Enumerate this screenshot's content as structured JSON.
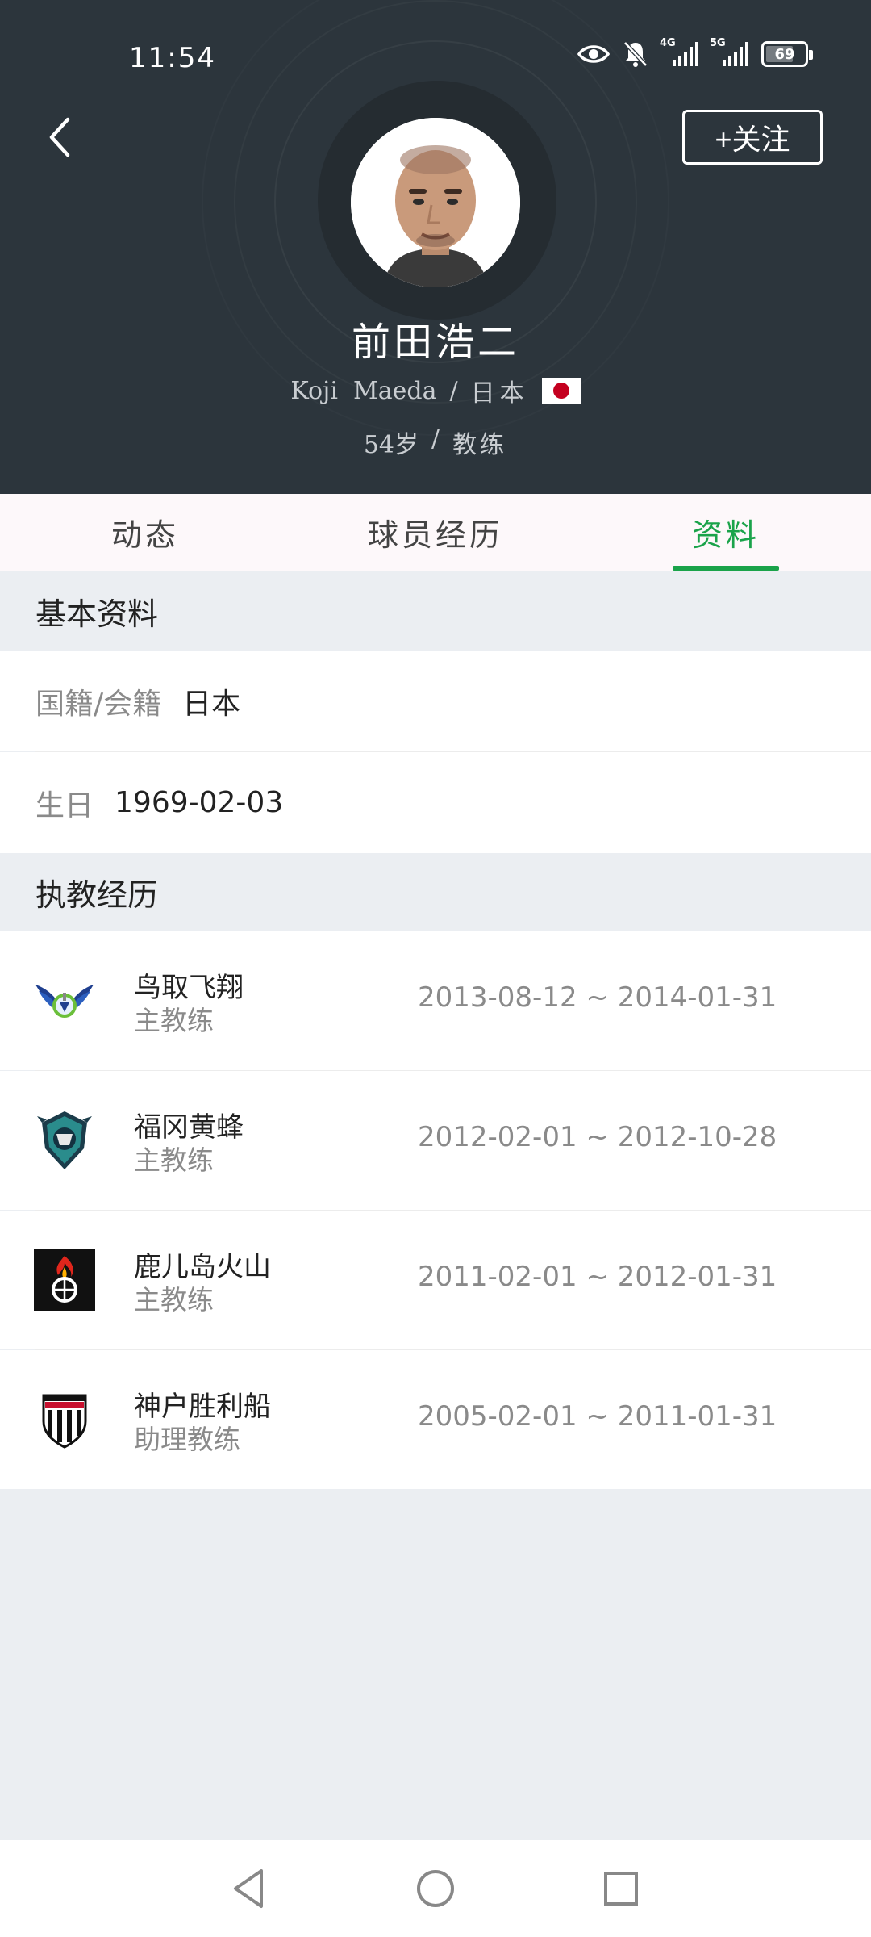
{
  "status_bar": {
    "time": "11:54",
    "network_1": "4G",
    "network_2": "5G",
    "battery": "69"
  },
  "header": {
    "follow_label": "+关注",
    "name": "前田浩二",
    "english_name": "Koji  Maeda",
    "sep": "/",
    "country": "日本",
    "age": "54岁",
    "role": "教练"
  },
  "tabs": [
    {
      "label": "动态",
      "active": false
    },
    {
      "label": "球员经历",
      "active": false
    },
    {
      "label": "资料",
      "active": true
    }
  ],
  "basic_info": {
    "title": "基本资料",
    "nationality_label": "国籍/会籍",
    "nationality_value": "日本",
    "birthday_label": "生日",
    "birthday_value": "1969-02-03"
  },
  "coaching": {
    "title": "执教经历",
    "items": [
      {
        "club": "鸟取飞翔",
        "role": "主教练",
        "dates": "2013-08-12 ~ 2014-01-31",
        "logo": "gainare-tottori-logo"
      },
      {
        "club": "福冈黄蜂",
        "role": "主教练",
        "dates": "2012-02-01 ~ 2012-10-28",
        "logo": "avispa-fukuoka-logo"
      },
      {
        "club": "鹿儿岛火山",
        "role": "主教练",
        "dates": "2011-02-01 ~ 2012-01-31",
        "logo": "volca-kagoshima-logo"
      },
      {
        "club": "神户胜利船",
        "role": "助理教练",
        "dates": "2005-02-01 ~ 2011-01-31",
        "logo": "vissel-kobe-logo"
      }
    ]
  },
  "colors": {
    "header_bg": "#2c353c",
    "accent": "#1aa34a",
    "page_bg": "#ebeef2"
  }
}
